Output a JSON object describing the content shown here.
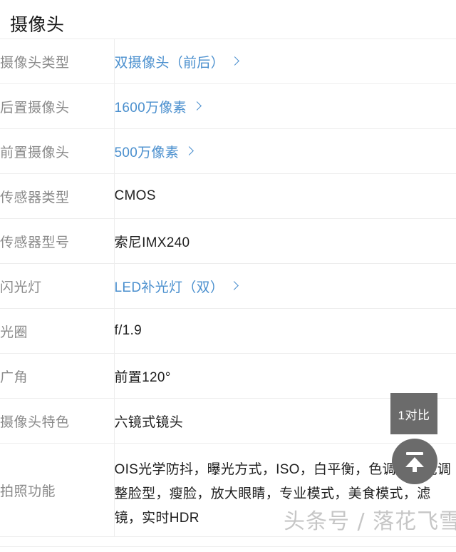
{
  "section": {
    "title": "摄像头"
  },
  "spec_rows": [
    {
      "label": "摄像头类型",
      "value": "双摄像头（前后）",
      "link": true
    },
    {
      "label": "后置摄像头",
      "value": "1600万像素",
      "link": true
    },
    {
      "label": "前置摄像头",
      "value": "500万像素",
      "link": true
    },
    {
      "label": "传感器类型",
      "value": "CMOS",
      "link": false
    },
    {
      "label": "传感器型号",
      "value": "索尼IMX240",
      "link": false
    },
    {
      "label": "闪光灯",
      "value": "LED补光灯（双）",
      "link": true
    },
    {
      "label": "光圈",
      "value": "f/1.9",
      "link": false
    },
    {
      "label": "广角",
      "value": "前置120°",
      "link": false
    },
    {
      "label": "摄像头特色",
      "value": "六镜式镜头",
      "link": false
    },
    {
      "label": "拍照功能",
      "value": "OIS光学防抖，曝光方式，ISO，白平衡，色调，智能调整脸型，瘦脸，放大眼睛，专业模式，美食模式，滤镜，实时HDR",
      "link": false
    }
  ],
  "overlays": {
    "compare_badge_label": "1对比",
    "scroll_top_icon": "upload-arrow-icon",
    "watermark_text": "头条号 / 落花飞雪"
  },
  "colors": {
    "link": "#4a8fce",
    "label_text": "#8a8a8a",
    "value_text": "#1f1f1f",
    "divider": "#ededed",
    "overlay_bg": "#6b6b6b"
  }
}
